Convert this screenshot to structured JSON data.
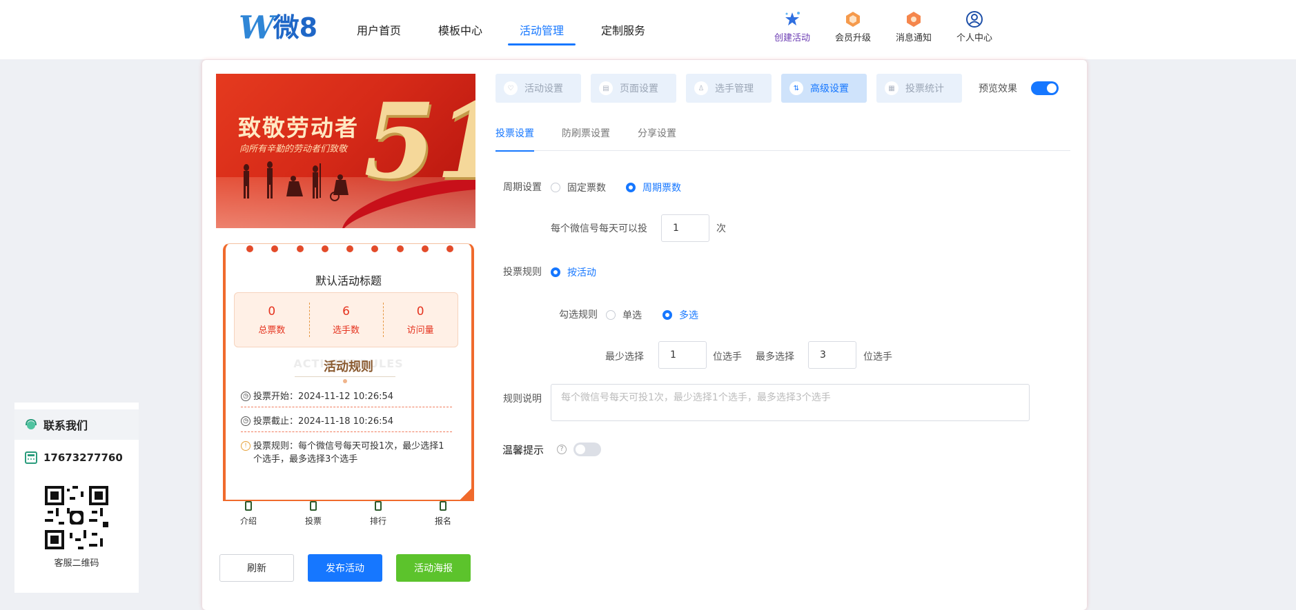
{
  "header": {
    "logo_text": "微8",
    "nav": [
      {
        "label": "用户首页",
        "active": false
      },
      {
        "label": "模板中心",
        "active": false
      },
      {
        "label": "活动管理",
        "active": true
      },
      {
        "label": "定制服务",
        "active": false
      }
    ],
    "tools": [
      {
        "label": "创建活动",
        "icon": "stars-icon"
      },
      {
        "label": "会员升级",
        "icon": "vip-badge-icon"
      },
      {
        "label": "消息通知",
        "icon": "bell-badge-icon"
      },
      {
        "label": "个人中心",
        "icon": "user-icon"
      }
    ]
  },
  "contact": {
    "title": "联系我们",
    "phone": "17673277760",
    "qr_label": "客服二维码"
  },
  "preview": {
    "banner_title": "致敬劳动者",
    "banner_subtitle": "向所有辛勤的劳动者们致敬",
    "banner_number": "51",
    "activity_title": "默认活动标题",
    "stats": [
      {
        "value": "0",
        "label": "总票数"
      },
      {
        "value": "6",
        "label": "选手数"
      },
      {
        "value": "0",
        "label": "访问量"
      }
    ],
    "rules_bg": "ACTIVITY RULES",
    "rules_title": "活动规则",
    "vote_start": "投票开始：2024-11-12 10:26:54",
    "vote_end": "投票截止：2024-11-18 10:26:54",
    "vote_rule": "投票规则：每个微信号每天可投1次，最少选择1个选手，最多选择3个选手",
    "tabs": [
      "介绍",
      "投票",
      "排行",
      "报名"
    ]
  },
  "actions": {
    "refresh": "刷新",
    "publish": "发布活动",
    "poster": "活动海报"
  },
  "settings": {
    "steps": [
      {
        "label": "活动设置",
        "active": false
      },
      {
        "label": "页面设置",
        "active": false
      },
      {
        "label": "选手管理",
        "active": false
      },
      {
        "label": "高级设置",
        "active": true
      },
      {
        "label": "投票统计",
        "active": false
      }
    ],
    "preview_label": "预览效果",
    "preview_on": true,
    "subtabs": [
      {
        "label": "投票设置",
        "active": true
      },
      {
        "label": "防刷票设置",
        "active": false
      },
      {
        "label": "分享设置",
        "active": false
      }
    ],
    "period_label": "周期设置",
    "period_options": [
      {
        "label": "固定票数",
        "checked": false
      },
      {
        "label": "周期票数",
        "checked": true
      }
    ],
    "daily_label": "每个微信号每天可以投",
    "daily_value": "1",
    "daily_unit": "次",
    "rule_label": "投票规则",
    "rule_option": "按活动",
    "select_label": "勾选规则",
    "select_options": [
      {
        "label": "单选",
        "checked": false
      },
      {
        "label": "多选",
        "checked": true
      }
    ],
    "min_label": "最少选择",
    "min_value": "1",
    "min_unit": "位选手",
    "max_label": "最多选择",
    "max_value": "3",
    "max_unit": "位选手",
    "desc_label": "规则说明",
    "desc_placeholder": "每个微信号每天可投1次，最少选择1个选手，最多选择3个选手",
    "tip_label": "温馨提示",
    "tip_on": false
  },
  "colors": {
    "primary": "#1677ff",
    "success": "#5cc32c",
    "banner_red": "#d62a18",
    "stat_red": "#e5331f"
  }
}
